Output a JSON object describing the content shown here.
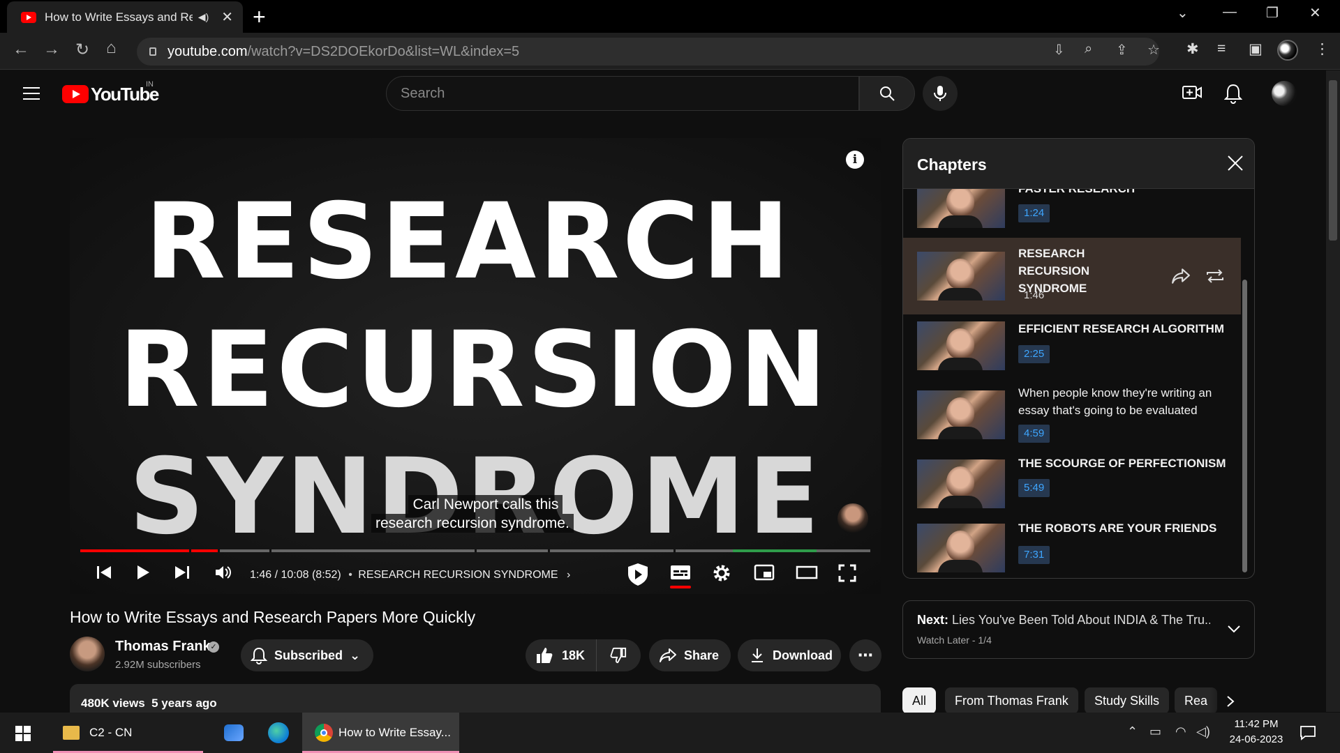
{
  "browser": {
    "tab_title": "How to Write Essays and Research Papers More Quickly",
    "url_host": "youtube.com",
    "url_path": "/watch?v=DS2DOEkorDo&list=WL&index=5",
    "new_tab": "+"
  },
  "masthead": {
    "logo_text": "YouTube",
    "country_code": "IN",
    "search_placeholder": "Search"
  },
  "player": {
    "thumbnail_lines": [
      "RESEARCH",
      "RECURSION",
      "SYNDROME"
    ],
    "caption_line1": "Carl Newport calls this",
    "caption_line2": "research recursion syndrome.",
    "info_glyph": "i",
    "time_text": "1:46 / 10:08 (8:52)",
    "separator": "•",
    "chapter_label": "RESEARCH RECURSION SYNDROME",
    "progress_fraction": 0.175
  },
  "video": {
    "title": "How to Write Essays and Research Papers More Quickly",
    "channel_name": "Thomas Frank",
    "verified_glyph": "✓",
    "subscribers": "2.92M subscribers",
    "subscribe_label": "Subscribed",
    "likes": "18K",
    "share_label": "Share",
    "download_label": "Download",
    "views_line": "480K views  5 years ago"
  },
  "chapters_panel": {
    "title": "Chapters",
    "items": [
      {
        "title": "FASTER RESEARCH",
        "time": "1:24",
        "caps": true
      },
      {
        "title": "RESEARCH RECURSION SYNDROME",
        "time": "1:46",
        "caps": true
      },
      {
        "title": "EFFICIENT RESEARCH ALGORITHM",
        "time": "2:25",
        "caps": true
      },
      {
        "title": "When people know they're writing an essay that's going to be evaluated",
        "time": "4:59",
        "caps": false
      },
      {
        "title": "THE SCOURGE OF PERFECTIONISM",
        "time": "5:49",
        "caps": true
      },
      {
        "title": "THE ROBOTS ARE YOUR FRIENDS",
        "time": "7:31",
        "caps": true
      }
    ]
  },
  "up_next": {
    "prefix": "Next:",
    "title": "Lies You've Been Told About INDIA & The Tru...",
    "playlist": "Watch Later - 1/4"
  },
  "chips": [
    "All",
    "From Thomas Frank",
    "Study Skills",
    "Rea"
  ],
  "taskbar": {
    "folder_label": "C2 - CN",
    "chrome_label": "How to Write Essay...",
    "time": "11:42 PM",
    "date": "24-06-2023"
  },
  "colors": {
    "youtube_red": "#ff0000",
    "chapter_time_blue": "#3ea6ff",
    "active_chapter_bg": "#3a2f29"
  }
}
